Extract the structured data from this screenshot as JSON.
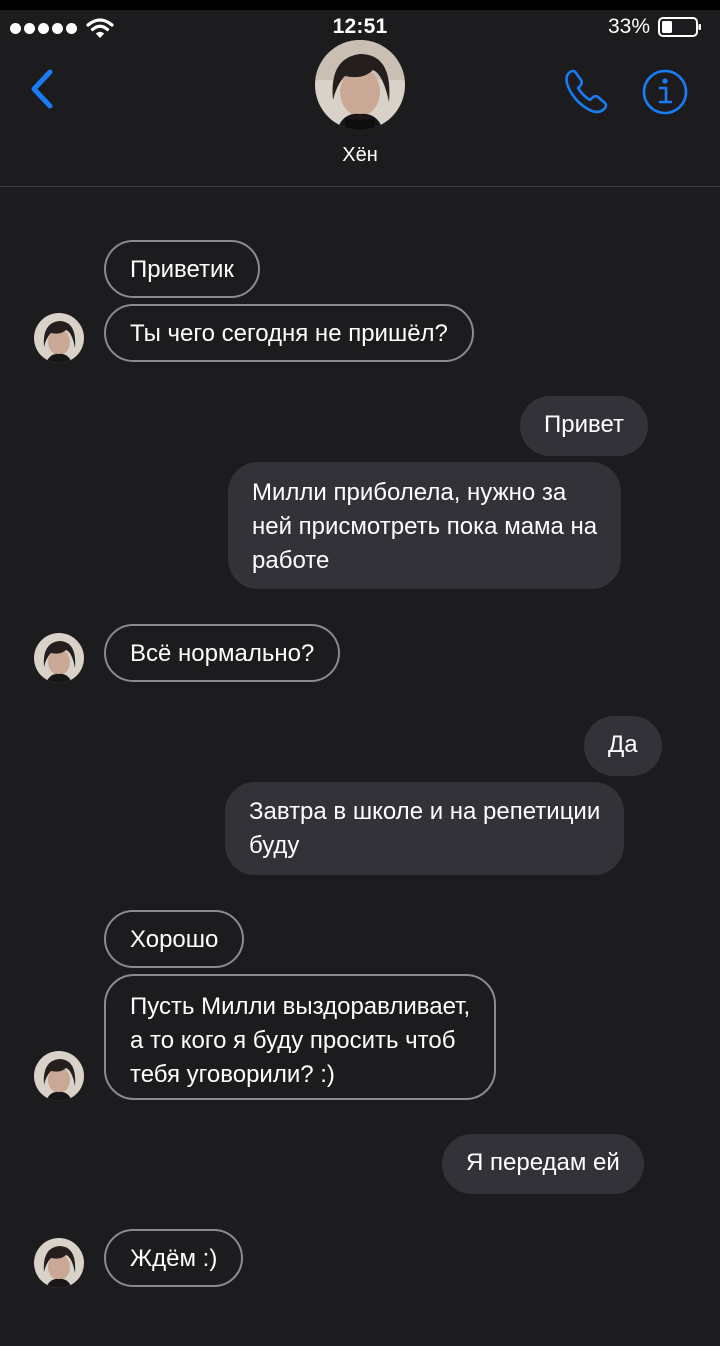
{
  "status_bar": {
    "time": "12:51",
    "battery": "33%"
  },
  "header": {
    "contact_name": "Хён"
  },
  "messages": [
    {
      "direction": "incoming",
      "text": "Приветик"
    },
    {
      "direction": "incoming",
      "text": "Ты чего сегодня не пришёл?"
    },
    {
      "direction": "outgoing",
      "text": "Привет"
    },
    {
      "direction": "outgoing",
      "text": "Милли приболела, нужно за\nней присмотреть пока мама на\nработе"
    },
    {
      "direction": "incoming",
      "text": "Всё нормально?"
    },
    {
      "direction": "outgoing",
      "text": "Да"
    },
    {
      "direction": "outgoing",
      "text": "Завтра в школе и на репетиции\nбуду"
    },
    {
      "direction": "incoming",
      "text": "Хорошо"
    },
    {
      "direction": "incoming",
      "text": "Пусть Милли выздоравливает,\nа то кого я буду просить чтоб\nтебя уговорили? :)"
    },
    {
      "direction": "outgoing",
      "text": "Я передам ей"
    },
    {
      "direction": "incoming",
      "text": "Ждём :)"
    }
  ],
  "colors": {
    "background": "#1c1b1e",
    "accent": "#1a7cf4",
    "outgoing_bubble": "#343239",
    "incoming_border": "#8b8a8f"
  },
  "icons": {
    "back": "chevron-left-icon",
    "call": "phone-icon",
    "info": "info-icon"
  }
}
